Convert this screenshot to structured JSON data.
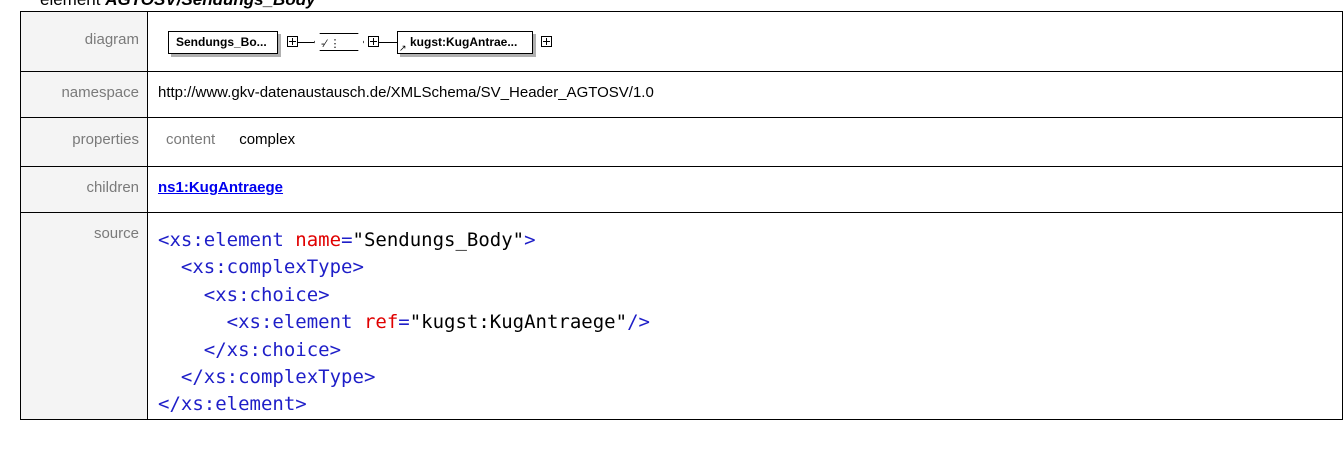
{
  "heading": {
    "kind": "element",
    "name": "AGTOSV/Sendungs_Body"
  },
  "rows": {
    "diagram": {
      "label": "diagram"
    },
    "namespace": {
      "label": "namespace",
      "value": "http://www.gkv-datenaustausch.de/XMLSchema/SV_Header_AGTOSV/1.0"
    },
    "properties": {
      "label": "properties",
      "key": "content",
      "value": "complex"
    },
    "children": {
      "label": "children",
      "link": "ns1:KugAntraege"
    },
    "source": {
      "label": "source"
    }
  },
  "diagram": {
    "box1": "Sendungs_Bo...",
    "box2": "kugst:KugAntrae...",
    "choice_icon": "choice-compositor-icon"
  },
  "source": {
    "lines": [
      {
        "indent": "",
        "open": "<",
        "tag": "xs:element",
        "attr": "name",
        "eq": "=",
        "val": "\"Sendungs_Body\"",
        "close": ">"
      },
      {
        "indent": "  ",
        "open": "<",
        "tag": "xs:complexType",
        "close": ">"
      },
      {
        "indent": "    ",
        "open": "<",
        "tag": "xs:choice",
        "close": ">"
      },
      {
        "indent": "      ",
        "open": "<",
        "tag": "xs:element",
        "attr": "ref",
        "eq": "=",
        "val": "\"kugst:KugAntraege\"",
        "close": "/>"
      },
      {
        "indent": "    ",
        "open": "</",
        "tag": "xs:choice",
        "close": ">"
      },
      {
        "indent": "  ",
        "open": "</",
        "tag": "xs:complexType",
        "close": ">"
      },
      {
        "indent": "",
        "open": "</",
        "tag": "xs:element",
        "close": ">"
      }
    ]
  },
  "colors": {
    "tag": "#1e1ec8",
    "attr": "#e00000",
    "link": "#0000ee",
    "label_bg": "#f4f4f4"
  }
}
